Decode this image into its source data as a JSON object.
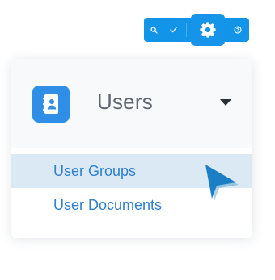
{
  "toolbar": {
    "icons": [
      "search-icon",
      "check-icon",
      "gear-icon",
      "help-icon"
    ],
    "color": "#1294e8"
  },
  "panel": {
    "header": {
      "icon": "address-book-icon",
      "label": "Users",
      "caret": "caret-down-icon",
      "icon_color": "#2f8ee6"
    },
    "items": [
      {
        "label": "User Groups",
        "active": true
      },
      {
        "label": "User Documents",
        "active": false
      }
    ],
    "link_color": "#2f7fcf",
    "active_bg": "#dbe9f4"
  },
  "cursor": {
    "icon": "pointer-arrow-icon",
    "color": "#1a7fc4"
  }
}
